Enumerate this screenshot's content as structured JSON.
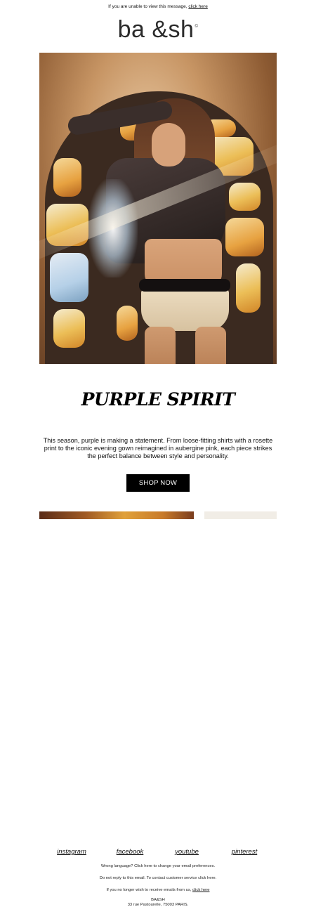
{
  "preheader": {
    "text": "If you are unable to view this message,",
    "link_label": "click here"
  },
  "brand": {
    "logo_text": "ba &sh",
    "registered_mark": "©"
  },
  "hero": {
    "image": "woman-stained-glass-arch-photo"
  },
  "headline": "PURPLE SPIRIT",
  "body_copy": "This season, purple is making a statement. From loose-fitting shirts with a rosette print to the iconic evening gown reimagined in aubergine pink, each piece strikes the perfect balance between style and personality.",
  "cta": {
    "label": "SHOP NOW"
  },
  "colors": {
    "button_bg": "#000000",
    "button_text": "#ffffff",
    "text": "#111111",
    "background": "#ffffff"
  },
  "social_links": [
    {
      "label": "instagram"
    },
    {
      "label": "facebook"
    },
    {
      "label": "youtube"
    },
    {
      "label": "pinterest"
    }
  ],
  "footer": {
    "language_note": "Wrong language? Click here to change your email preferences.",
    "no_reply_note": "Do not reply to this email. To contact customer service click here.",
    "unsubscribe_text": "If you no longer wish to receive emails from us,",
    "unsubscribe_link": "click here",
    "company_name": "BA&SH",
    "address": "33 rue Pastourelle, 75003 PARIS."
  }
}
